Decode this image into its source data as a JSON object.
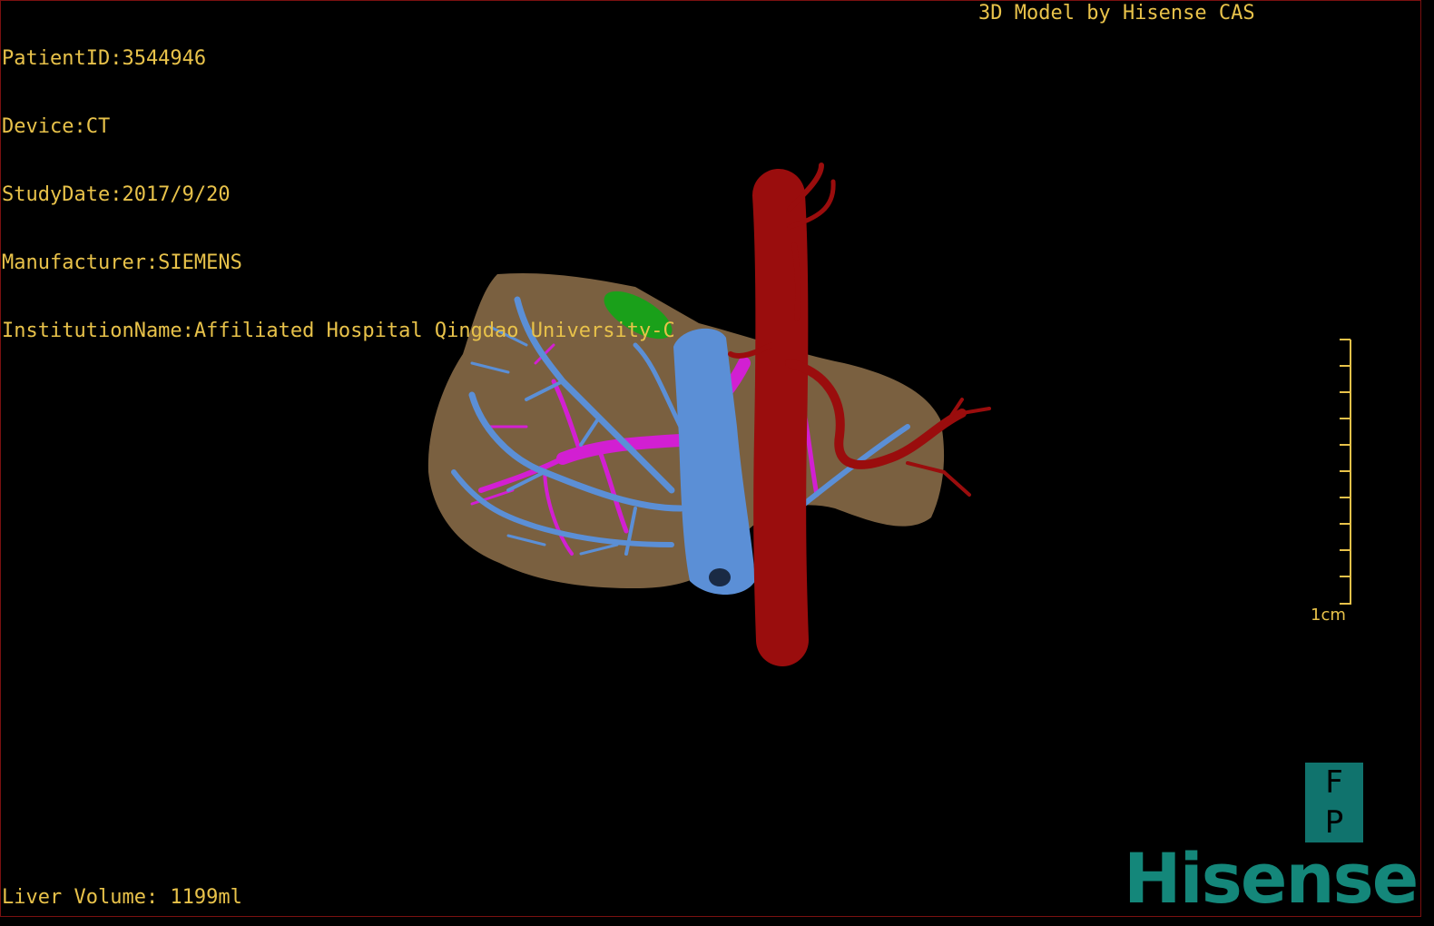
{
  "overlay": {
    "patient_id": "PatientID:3544946",
    "device": "Device:CT",
    "study_date": "StudyDate:2017/9/20",
    "manufacturer": "Manufacturer:SIEMENS",
    "institution": "InstitutionName:Affiliated Hospital Qingdao University-C",
    "credit": "3D Model by Hisense CAS",
    "liver_volume": "Liver Volume: 1199ml"
  },
  "scale_bar": {
    "label": "1cm"
  },
  "orientation": {
    "top": "F",
    "bottom": "P"
  },
  "brand": {
    "name": "Hisense"
  },
  "colors": {
    "text": "#e8c24a",
    "liver": "#7a6040",
    "hepatic_vein": "#5b8fd6",
    "portal_vein": "#d21fd2",
    "artery": "#9a0d0d",
    "gallbladder": "#1aa01a",
    "brand": "#14877a"
  }
}
